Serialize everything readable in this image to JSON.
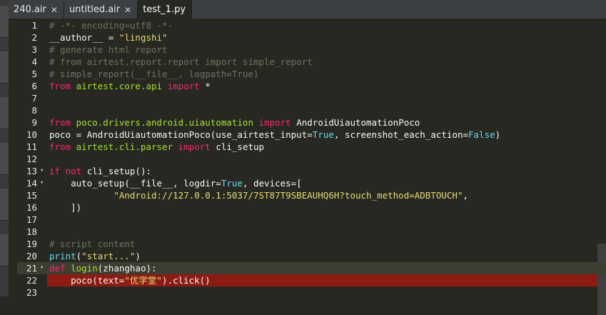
{
  "tabs": [
    {
      "label": "240.air",
      "active": false
    },
    {
      "label": "untitled.air",
      "active": false
    },
    {
      "label": "test_1.py",
      "active": true
    }
  ],
  "close_glyph": "✕",
  "fold_glyph": "▾",
  "lines": [
    {
      "n": "1",
      "text": "# -*- encoding=utf8 -*-"
    },
    {
      "n": "2",
      "text": "__author__ = \"lingshi\""
    },
    {
      "n": "3",
      "text": "# generate html report"
    },
    {
      "n": "4",
      "text": "# from airtest.report.report import simple_report"
    },
    {
      "n": "5",
      "text": "# simple_report(__file__, logpath=True)"
    },
    {
      "n": "6",
      "text": "from airtest.core.api import *"
    },
    {
      "n": "7",
      "text": ""
    },
    {
      "n": "8",
      "text": ""
    },
    {
      "n": "9",
      "text": "from poco.drivers.android.uiautomation import AndroidUiautomationPoco"
    },
    {
      "n": "10",
      "text": "poco = AndroidUiautomationPoco(use_airtest_input=True, screenshot_each_action=False)"
    },
    {
      "n": "11",
      "text": "from airtest.cli.parser import cli_setup"
    },
    {
      "n": "12",
      "text": ""
    },
    {
      "n": "13",
      "text": "if not cli_setup():"
    },
    {
      "n": "14",
      "text": "    auto_setup(__file__, logdir=True, devices=["
    },
    {
      "n": "15",
      "text": "            \"Android://127.0.0.1:5037/7ST87T9SBEAUHQ6H?touch_method=ADBTOUCH\","
    },
    {
      "n": "16",
      "text": "    ])"
    },
    {
      "n": "17",
      "text": ""
    },
    {
      "n": "18",
      "text": ""
    },
    {
      "n": "19",
      "text": "# script content"
    },
    {
      "n": "20",
      "text": "print(\"start...\")"
    },
    {
      "n": "21",
      "text": "def login(zhanghao):"
    },
    {
      "n": "22",
      "text": "    poco(text=\"优学堂\").click()"
    },
    {
      "n": "23",
      "text": ""
    }
  ],
  "colors": {
    "comment": "#75715e",
    "keyword": "#f92672",
    "string": "#e6db74",
    "module": "#a6e22e",
    "constant": "#66d9ef",
    "param": "#fd971f",
    "error_line": "#8c1c13",
    "current_line": "#3e3d32"
  }
}
